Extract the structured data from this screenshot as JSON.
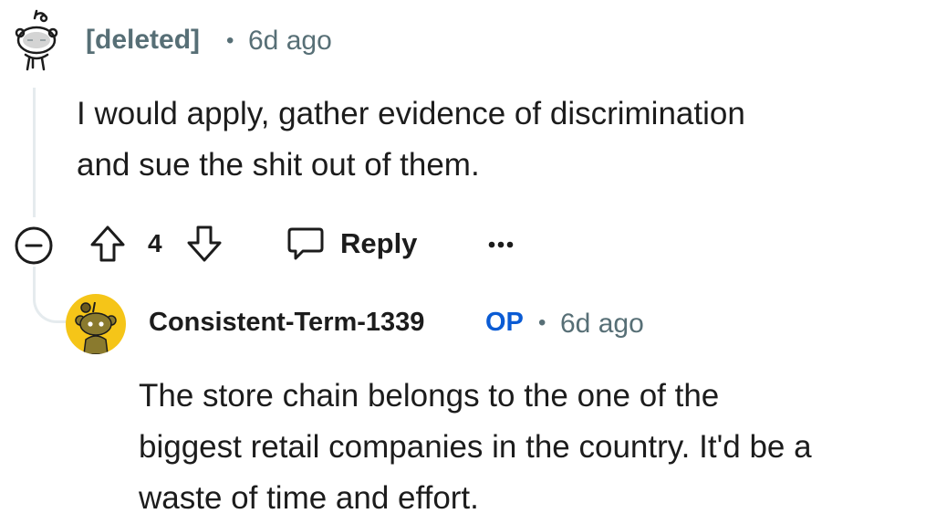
{
  "comment": {
    "author": "[deleted]",
    "separator": "•",
    "time": "6d ago",
    "body_line1": "I would apply, gather evidence of discrimination",
    "body_line2": "and sue the shit out of them.",
    "avatar_icon": "deleted-user-avatar-icon",
    "actions": {
      "collapse_icon": "collapse-minus-icon",
      "upvote_icon": "upvote-arrow-icon",
      "score": "4",
      "downvote_icon": "downvote-arrow-icon",
      "reply_icon": "speech-bubble-icon",
      "reply_label": "Reply",
      "more_icon": "more-dots-icon"
    }
  },
  "reply": {
    "author": "Consistent-Term-1339",
    "op_badge": "OP",
    "separator": "•",
    "time": "6d ago",
    "avatar_icon": "snoo-avatar-icon",
    "avatar_color": "#f5c518",
    "body_line1": "The store chain belongs to the one of the",
    "body_line2": "biggest retail companies in the country. It'd be a",
    "body_line3": "waste of time and effort."
  },
  "colors": {
    "meta_gray": "#576f76",
    "op_blue": "#0a5bd4",
    "thread_line": "#e5ebee"
  }
}
